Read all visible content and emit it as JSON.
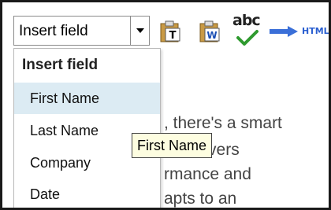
{
  "toolbar": {
    "field_combo_value": "Insert field",
    "spellcheck_text": "abc",
    "html_label": "HTML"
  },
  "dropdown": {
    "header": "Insert field",
    "items": [
      "First Name",
      "Last Name",
      "Company",
      "Date"
    ],
    "highlighted_index": 0
  },
  "tooltip": {
    "text": "First Name"
  },
  "body": {
    "lines": [
      ", there's a smart",
      "at delivers",
      "rmance and",
      "apts to an"
    ]
  },
  "colors": {
    "highlight": "#dcebf3",
    "tooltip_bg": "#fdfde0",
    "accent_blue": "#2a5fd0",
    "check_green": "#2f9a2f"
  },
  "icons": [
    "chevron-down-icon",
    "text-clipboard-icon",
    "word-clipboard-icon",
    "spellcheck-icon",
    "arrow-right-icon"
  ]
}
